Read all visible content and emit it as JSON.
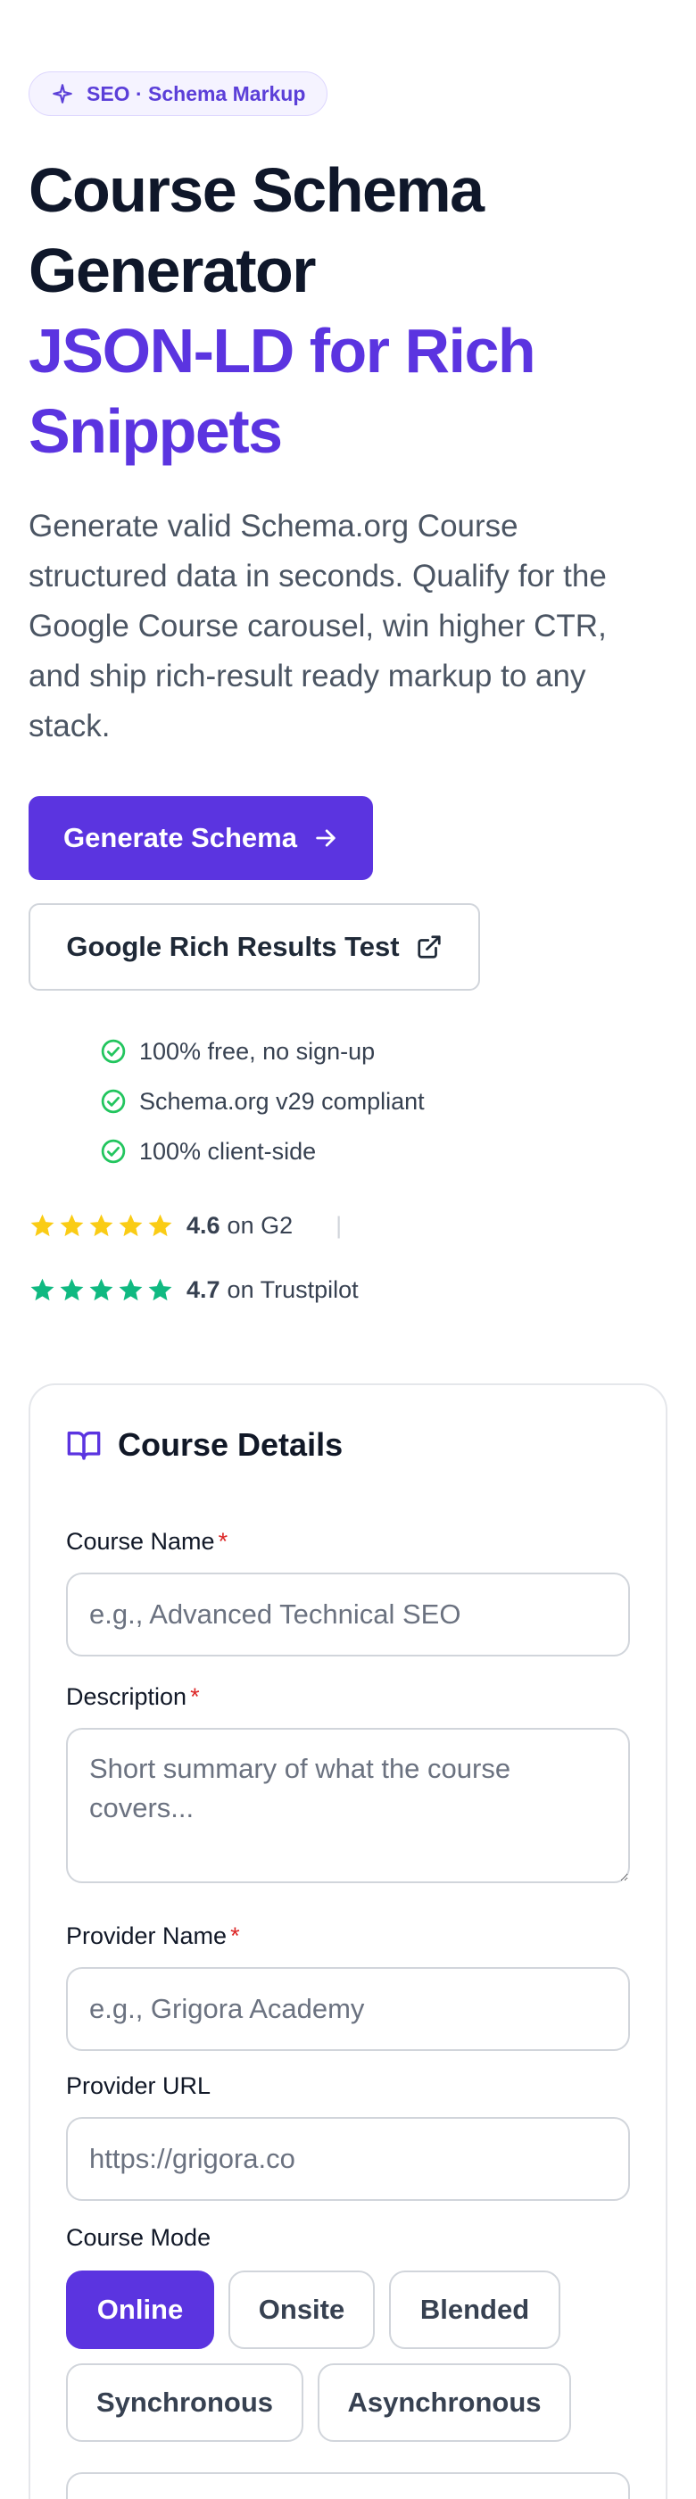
{
  "badge": {
    "label": "SEO · Schema Markup",
    "icon": "sparkle-icon"
  },
  "hero": {
    "title_line1": "Course Schema Generator",
    "title_line2": "JSON-LD for Rich Snippets",
    "description": "Generate valid Schema.org Course structured data in seconds. Qualify for the Google Course carousel, win higher CTR, and ship rich-result ready markup to any stack."
  },
  "actions": {
    "primary_label": "Generate Schema",
    "secondary_label": "Google Rich Results Test"
  },
  "checks": [
    "100% free, no sign-up",
    "Schema.org v29 compliant",
    "100% client-side"
  ],
  "ratings": [
    {
      "score": "4.6",
      "source": "on G2",
      "color": "#facc15",
      "stars": 5
    },
    {
      "score": "4.7",
      "source": "on Trustpilot",
      "color": "#10b981",
      "stars": 5
    }
  ],
  "card": {
    "title": "Course Details",
    "fields": {
      "course_name": {
        "label": "Course Name",
        "placeholder": "e.g., Advanced Technical SEO",
        "required": "*"
      },
      "description": {
        "label": "Description",
        "placeholder": "Short summary of what the course covers...",
        "required": "*"
      },
      "provider_name": {
        "label": "Provider Name",
        "placeholder": "e.g., Grigora Academy",
        "required": "*"
      },
      "provider_url": {
        "label": "Provider URL",
        "placeholder": "https://grigora.co"
      }
    },
    "course_mode": {
      "label": "Course Mode",
      "options": [
        "Online",
        "Onsite",
        "Blended",
        "Synchronous",
        "Asynchronous"
      ],
      "selected": "Online"
    }
  },
  "colors": {
    "accent": "#5b34e0",
    "check_green": "#22c55e",
    "required_red": "#dc2626"
  }
}
